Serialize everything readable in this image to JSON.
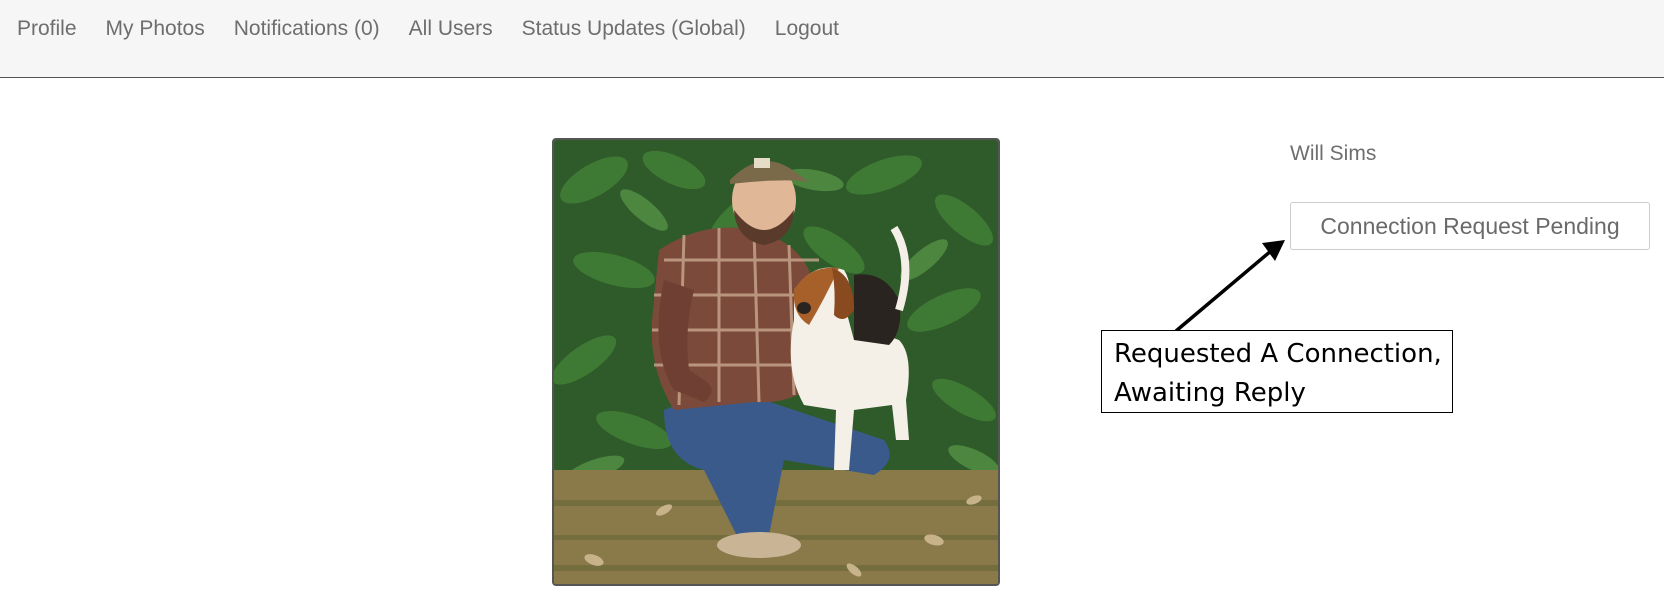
{
  "nav": {
    "items": [
      {
        "label": "Profile",
        "name": "nav-profile"
      },
      {
        "label": "My Photos",
        "name": "nav-my-photos"
      },
      {
        "label": "Notifications (0)",
        "name": "nav-notifications"
      },
      {
        "label": "All Users",
        "name": "nav-all-users"
      },
      {
        "label": "Status Updates (Global)",
        "name": "nav-status-updates"
      },
      {
        "label": "Logout",
        "name": "nav-logout"
      }
    ]
  },
  "profile": {
    "photo_description_icon": "profile-photo",
    "name": "Will Sims",
    "connection_button_label": "Connection Request Pending"
  },
  "annotation": {
    "line1": "Requested A Connection,",
    "line2": "Awaiting Reply"
  },
  "colors": {
    "nav_background": "#f6f6f6",
    "nav_text": "#6e6e6e",
    "button_border": "#cccccc"
  }
}
